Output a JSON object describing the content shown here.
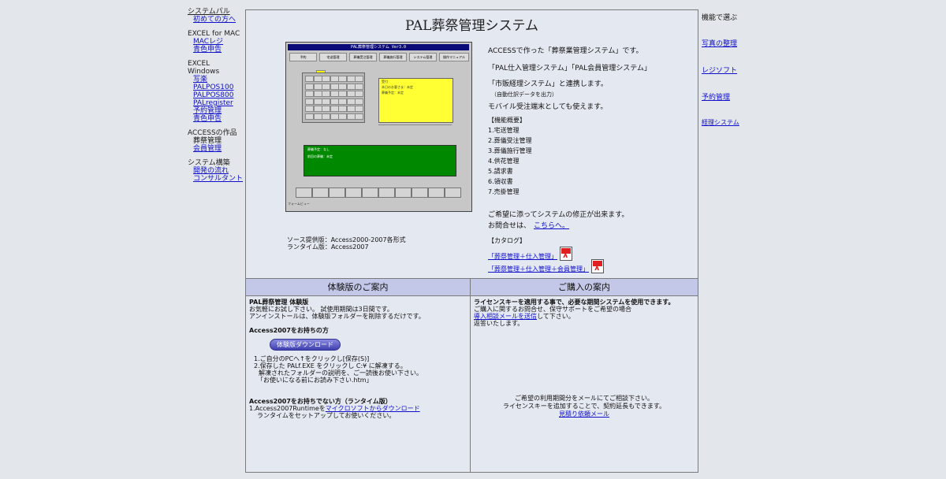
{
  "left_nav": {
    "groups": [
      {
        "items": [
          {
            "label": "システムパル",
            "link": true
          },
          {
            "label": "初めての方へ",
            "link": true,
            "sub": true
          }
        ]
      },
      {
        "header": "EXCEL for MAC",
        "items": [
          {
            "label": "MACレジ",
            "link": true,
            "sub": true
          },
          {
            "label": "青色申告",
            "link": true,
            "sub": true
          }
        ]
      },
      {
        "header": "EXCEL Windows",
        "items": [
          {
            "label": "写楽",
            "link": true,
            "sub": true
          },
          {
            "label": "PALPOS100",
            "link": true,
            "sub": true
          },
          {
            "label": "PALPOS800",
            "link": true,
            "sub": true
          },
          {
            "label": "PALregister",
            "link": true,
            "sub": true
          },
          {
            "label": "予約管理",
            "link": true,
            "sub": true
          },
          {
            "label": "青色申告",
            "link": true,
            "sub": true
          }
        ]
      },
      {
        "header": "ACCESSの作品",
        "items": [
          {
            "label": "葬祭管理",
            "link": false,
            "sub": true
          },
          {
            "label": "会員管理",
            "link": true,
            "sub": true
          }
        ]
      },
      {
        "header": "システム構築",
        "items": [
          {
            "label": "開発の流れ",
            "link": true,
            "sub": true
          },
          {
            "label": "コンサルタント",
            "link": true,
            "sub": true
          }
        ]
      }
    ]
  },
  "right_nav": {
    "header": "機能で選ぶ",
    "items": [
      "写真の整理",
      "レジソフト",
      "予約管理",
      "経理システム"
    ]
  },
  "main": {
    "title": "PAL葬祭管理システム",
    "screenshot": {
      "titlebar": "PAL葬祭管理システム Ver3.0",
      "tabs": [
        "予約",
        "宅送管理",
        "葬儀受注管理",
        "葬儀施行管理",
        "システム管理",
        "操作マニュアル"
      ],
      "note": "受付",
      "note_lines": [
        "本日のお客さま：未定",
        "葬儀予定：未定"
      ],
      "green_lines": [
        "葬儀予定：なし",
        "前回の葬儀：未定"
      ],
      "status": "フォームビュー"
    },
    "source_info": [
      "ソース提供版：Access2000-2007各形式",
      "ランタイム版：Access2007"
    ],
    "description": [
      "ACCESSで作った「葬祭業管理システム」です。",
      "「PAL仕入管理システム」「PAL会員管理システム」",
      "「市販経理システム」と連携します。"
    ],
    "desc_note": "（自動仕訳データを出力）",
    "desc_last": "モバイル受注端末としても使えます。",
    "features_title": "【機能概要】",
    "features": [
      "1.宅送管理",
      "2.葬儀受注管理",
      "3.葬儀施行管理",
      "4.供花管理",
      "5.請求書",
      "6.領収書",
      "7.売掛管理"
    ],
    "consult_line": "ご希望に添ってシステムの修正が出来ます。",
    "contact_prefix": "お問合せは、",
    "contact_link": "こちらへ。",
    "catalog_title": "【カタログ】",
    "catalogs": [
      "「葬祭管理＋仕入管理」",
      "「葬祭管理＋仕入管理＋会員管理」"
    ]
  },
  "trial": {
    "header": "体験版のご案内",
    "product": "PAL葬祭管理 体験版",
    "intro": [
      "お気軽にお試し下さい。 試使用期間は3日間です。",
      "アンインストールは、体験版フォルダーを削除するだけです。"
    ],
    "have_title": "Access2007をお持ちの方",
    "download_btn": "体験版ダウンロード",
    "steps": [
      "1.ご自分のPCへ↑をクリックし[保存(S)]",
      "2.保存した PALf.EXE をクリックし C:¥ に解凍する。",
      "解凍されたフォルダーの説明を、ご一読後お使い下さい。",
      "「お使いになる前にお読み下さい.htm」"
    ],
    "nohave_title": "Access2007をお持ちでない方（ランタイム版）",
    "runtime_prefix": "1.Access2007Runtimeを",
    "runtime_link": "マイクロソフトからダウンロード",
    "runtime_line2": "ランタイムをセットアップしてお使いください。"
  },
  "buy": {
    "header": "ご購入の案内",
    "license": "ライセンスキーを適用する事で、必要な期間システムを使用できます。",
    "line1": "ご購入に関するお問合せ、保守サポートをご希望の場合",
    "link1": "導入相談メールを送信",
    "link1_suffix": "して下さい。",
    "line2": "返答いたします。",
    "foot": [
      "ご希望の利用期間分をメールにてご相談下さい。",
      "ライセンスキーを追加することで、契約延長もできます。"
    ],
    "quote_link": "見積り依頼メール"
  }
}
